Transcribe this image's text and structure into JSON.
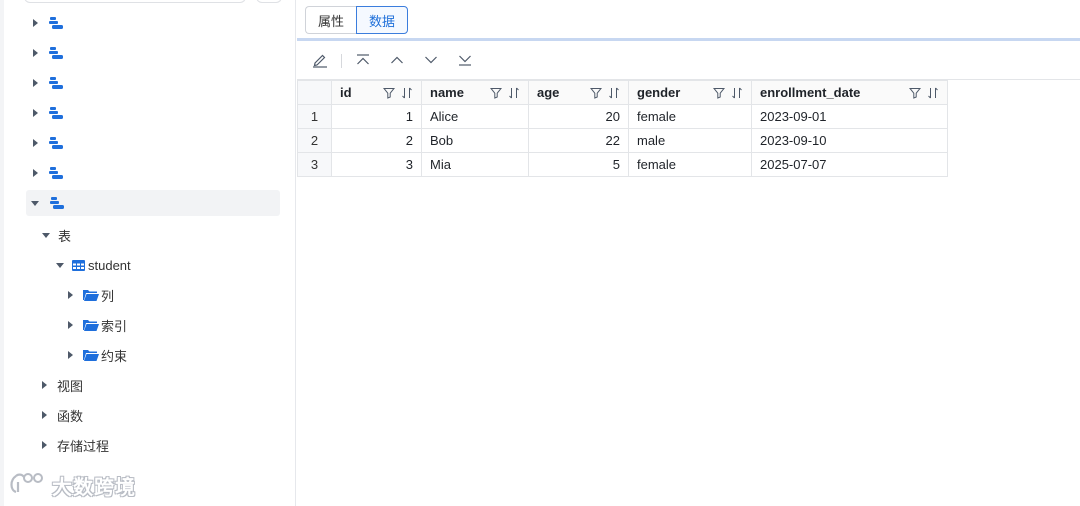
{
  "sidebar": {
    "tree_nodes_collapsed_count": 6,
    "expanded_node": {
      "categories": [
        {
          "label": "表",
          "expanded": true,
          "children": [
            {
              "label": "student",
              "expanded": true,
              "children": [
                {
                  "label": "列"
                },
                {
                  "label": "索引"
                },
                {
                  "label": "约束"
                }
              ]
            }
          ]
        },
        {
          "label": "视图",
          "expanded": false
        },
        {
          "label": "函数",
          "expanded": false
        },
        {
          "label": "存储过程",
          "expanded": false
        }
      ]
    },
    "watermark": "大数跨境"
  },
  "tabs": [
    {
      "label": "属性",
      "active": false
    },
    {
      "label": "数据",
      "active": true
    }
  ],
  "toolbar": {
    "icons": [
      "edit-icon",
      "first-record-icon",
      "previous-record-icon",
      "next-record-icon",
      "last-record-icon"
    ]
  },
  "grid": {
    "columns": [
      {
        "name": "id",
        "align": "right"
      },
      {
        "name": "name",
        "align": "left"
      },
      {
        "name": "age",
        "align": "right"
      },
      {
        "name": "gender",
        "align": "left"
      },
      {
        "name": "enrollment_date",
        "align": "left"
      }
    ],
    "rows": [
      {
        "rownum": "1",
        "cells": [
          "1",
          "Alice",
          "20",
          "female",
          "2023-09-01"
        ]
      },
      {
        "rownum": "2",
        "cells": [
          "2",
          "Bob",
          "22",
          "male",
          "2023-09-10"
        ]
      },
      {
        "rownum": "3",
        "cells": [
          "3",
          "Mia",
          "5",
          "female",
          "2025-07-07"
        ]
      }
    ]
  },
  "colors": {
    "accent": "#1e6fd9",
    "icon_blue": "#1f6fdc",
    "border": "#e3e5e8"
  }
}
